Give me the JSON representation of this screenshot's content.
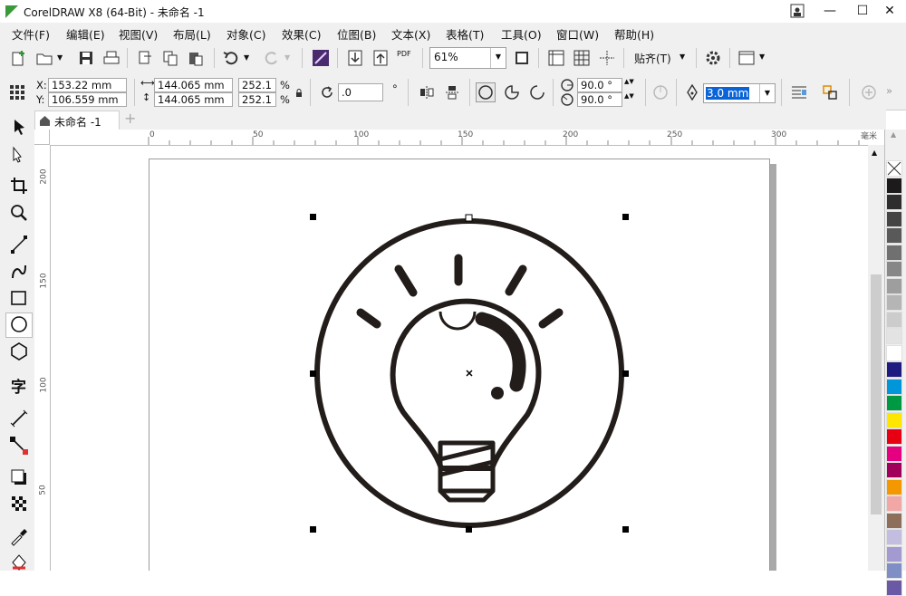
{
  "window": {
    "title": "CorelDRAW X8 (64-Bit) - 未命名 -1",
    "minimize": "—",
    "maximize": "☐",
    "close": "✕"
  },
  "menu": [
    "文件(F)",
    "编辑(E)",
    "视图(V)",
    "布局(L)",
    "对象(C)",
    "效果(C)",
    "位图(B)",
    "文本(X)",
    "表格(T)",
    "工具(O)",
    "窗口(W)",
    "帮助(H)"
  ],
  "toolbar": {
    "zoom": "61%",
    "snap_label": "贴齐(T)",
    "pdf_label": "PDF"
  },
  "properties": {
    "x_label": "X:",
    "x": "153.22 mm",
    "y_label": "Y:",
    "y": "106.559 mm",
    "width": "144.065 mm",
    "height": "144.065 mm",
    "scale_w": "252.1",
    "scale_h": "252.1",
    "pct": "%",
    "rotation": ".0",
    "degree_sign": "°",
    "start_angle": "90.0 °",
    "end_angle": "90.0 °",
    "outline_width": "3.0 mm"
  },
  "doc_tab": {
    "label": "未命名 -1",
    "add": "+"
  },
  "ruler": {
    "h_ticks": [
      "0",
      "50",
      "100",
      "150",
      "200",
      "250",
      "300"
    ],
    "unit": "毫米",
    "v_ticks": [
      "200",
      "150",
      "100",
      "50"
    ]
  },
  "palette": [
    "#ffffff",
    "#1c1a1a",
    "#2e2e2e",
    "#444444",
    "#595959",
    "#707070",
    "#878787",
    "#9e9e9e",
    "#b5b5b5",
    "#cccccc",
    "#e3e3e3",
    "#ffffff",
    "#1f1c7f",
    "#0096d9",
    "#009943",
    "#ffe600",
    "#e60012",
    "#e4007f",
    "#a0005a",
    "#f39800",
    "#f2a7a7",
    "#8c6e5a",
    "#c3bde0",
    "#a29ad0",
    "#7f8fc6",
    "#6a5aa6"
  ]
}
